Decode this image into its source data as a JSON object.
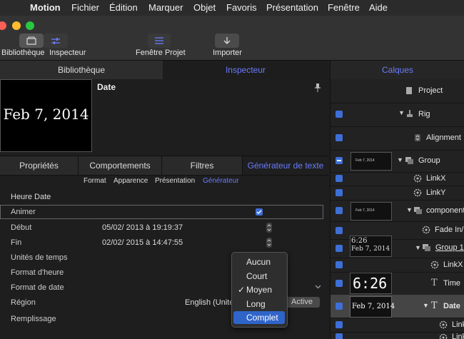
{
  "menubar": {
    "app": "Motion",
    "items": [
      "Fichier",
      "Édition",
      "Marquer",
      "Objet",
      "Favoris",
      "Présentation",
      "Fenêtre",
      "Aide"
    ]
  },
  "toolbar": {
    "bibliotheque": "Bibliothèque",
    "inspecteur": "Inspecteur",
    "fenetre_projet": "Fenêtre Projet",
    "importer": "Importer"
  },
  "left_tabs": {
    "bibliotheque": "Bibliothèque",
    "inspecteur": "Inspecteur"
  },
  "preview": {
    "text": "Feb 7, 2014",
    "title": "Date"
  },
  "sub_tabs": [
    "Propriétés",
    "Comportements",
    "Filtres",
    "Générateur de texte"
  ],
  "format_tabs": [
    "Format",
    "Apparence",
    "Présentation",
    "Générateur"
  ],
  "inspector": {
    "section": "Heure Date",
    "animer": "Animer",
    "debut_label": "Début",
    "debut_value": "05/02/ 2013 à  19:19:37",
    "fin_label": "Fin",
    "fin_value": "02/02/ 2015 à  14:47:55",
    "unites": "Unités de temps",
    "format_heure": "Format d'heure",
    "format_date": "Format de date",
    "region": "Région",
    "region_value": "English (Unite",
    "active": "Active",
    "remplissage": "Remplissage"
  },
  "dropdown": {
    "options": [
      "Aucun",
      "Court",
      "Moyen",
      "Long",
      "Complet"
    ],
    "selected": "Moyen",
    "highlighted": "Complet"
  },
  "layers": {
    "tab": "Calques",
    "project": "Project",
    "rig": "Rig",
    "alignment": "Alignment",
    "group": "Group",
    "linkx": "LinkX",
    "linky": "LinkY",
    "component": "component",
    "fade": "Fade In/",
    "group1": "Group 1",
    "linkx2": "LinkX",
    "time": "Time",
    "date": "Date",
    "link_a": "Link",
    "link_b": "Link",
    "thumb_time": "6:26",
    "thumb_date": "Feb 7, 2014",
    "thumb_small": "Feb 7, 2014"
  },
  "colors": {
    "accent": "#3d6fd6",
    "active_tab": "#6a7cff",
    "highlight": "#2f64c9"
  }
}
